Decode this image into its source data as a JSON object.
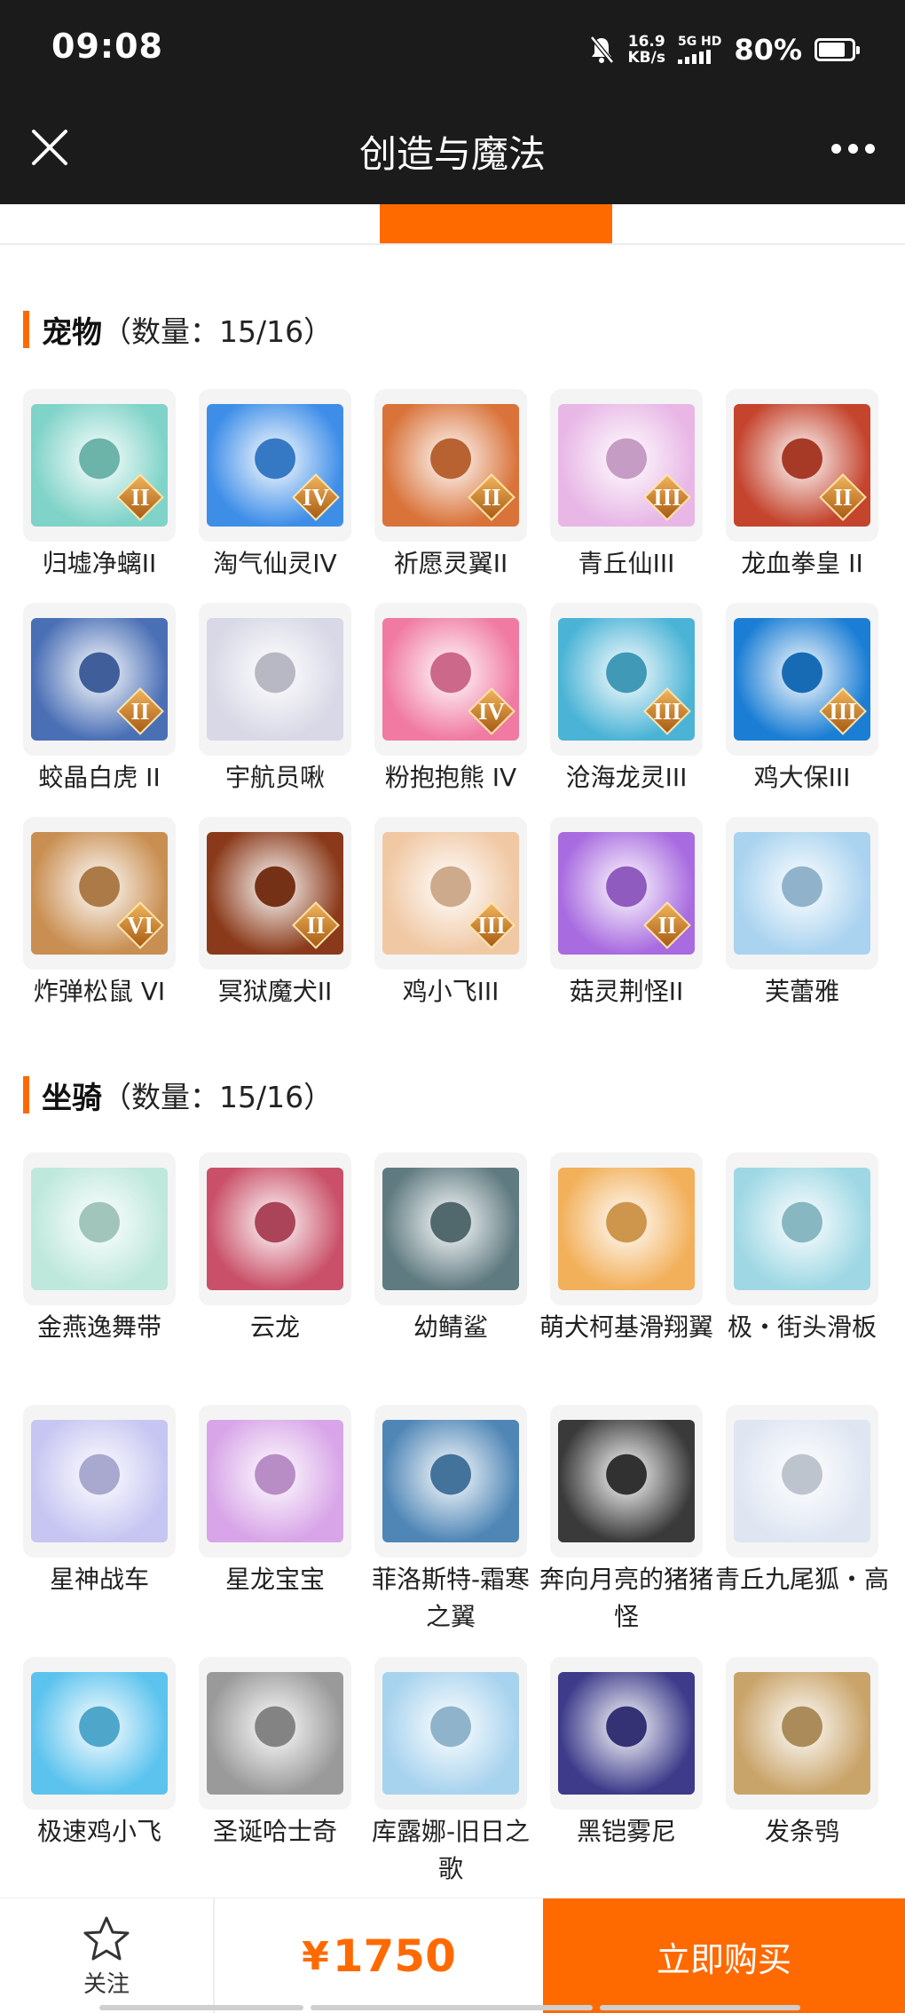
{
  "status_bar": {
    "time": "09:08",
    "speed_value": "16.9",
    "speed_unit": "KB/s",
    "network": "5G HD",
    "battery": "80%",
    "battery_level": 0.8
  },
  "header": {
    "title": "创造与魔法",
    "close_icon": "close-icon",
    "more_icon": "more-icon"
  },
  "pets": {
    "name": "宠物",
    "count": "（数量：15/16）",
    "items": [
      {
        "label": "归墟净螭II",
        "badge": "II",
        "color": "#7fd3c8",
        "icon": "dragon-icon"
      },
      {
        "label": "淘气仙灵IV",
        "badge": "IV",
        "color": "#3e8ee8",
        "icon": "pet-icon"
      },
      {
        "label": "祈愿灵翼II",
        "badge": "II",
        "color": "#d9733a",
        "icon": "bird-icon"
      },
      {
        "label": "青丘仙III",
        "badge": "III",
        "color": "#e8b7e6",
        "icon": "fox-spirit-icon"
      },
      {
        "label": "龙血拳皇 II",
        "badge": "II",
        "color": "#c4442e",
        "icon": "beast-icon"
      },
      {
        "label": "蛟晶白虎 II",
        "badge": "II",
        "color": "#4a6fb5",
        "icon": "tiger-icon"
      },
      {
        "label": "宇航员啾",
        "badge": "",
        "color": "#d8d8e6",
        "icon": "astronaut-icon"
      },
      {
        "label": "粉抱抱熊 IV",
        "badge": "IV",
        "color": "#f07aa2",
        "icon": "bear-icon"
      },
      {
        "label": "沧海龙灵III",
        "badge": "III",
        "color": "#4bb4d6",
        "icon": "dragon-spirit-icon"
      },
      {
        "label": "鸡大保III",
        "badge": "III",
        "color": "#1b7ed4",
        "icon": "chicken-icon"
      },
      {
        "label": "炸弹松鼠 VI",
        "badge": "VI",
        "color": "#c98f52",
        "icon": "squirrel-icon"
      },
      {
        "label": "冥狱魔犬II",
        "badge": "II",
        "color": "#8a3a1a",
        "icon": "hound-icon"
      },
      {
        "label": "鸡小飞III",
        "badge": "III",
        "color": "#f0c8a4",
        "icon": "chick-icon"
      },
      {
        "label": "菇灵荆怪II",
        "badge": "II",
        "color": "#a86be0",
        "icon": "mushroom-icon"
      },
      {
        "label": "芙蕾雅",
        "badge": "",
        "color": "#a9d3ef",
        "icon": "valkyrie-icon"
      }
    ]
  },
  "mounts": {
    "name": "坐骑",
    "count": "（数量：15/16）",
    "items": [
      {
        "label": "金燕逸舞带",
        "color": "#bfe8dc",
        "icon": "ribbon-icon"
      },
      {
        "label": "云龙",
        "color": "#c95068",
        "icon": "dragon-icon"
      },
      {
        "label": "幼鲭鲨",
        "color": "#5f7a80",
        "icon": "shark-icon"
      },
      {
        "label": "萌犬柯基滑翔翼",
        "color": "#f2b05a",
        "icon": "corgi-icon"
      },
      {
        "label": "极・街头滑板",
        "color": "#9fd8e4",
        "icon": "skateboard-icon"
      },
      {
        "label": "星神战车",
        "color": "#c7c6f2",
        "icon": "chariot-icon"
      },
      {
        "label": "星龙宝宝",
        "color": "#d8a6e8",
        "icon": "baby-dragon-icon"
      },
      {
        "label": "菲洛斯特-霜寒之翼",
        "color": "#4f86b6",
        "icon": "frost-wing-icon"
      },
      {
        "label": "奔向月亮的猪猪怪",
        "color": "#3a3a3a",
        "icon": "pig-icon"
      },
      {
        "label": "青丘九尾狐・高",
        "color": "#dfe6f2",
        "icon": "fox-icon"
      },
      {
        "label": "极速鸡小飞",
        "color": "#5cc3ee",
        "icon": "bird-icon"
      },
      {
        "label": "圣诞哈士奇",
        "color": "#9a9a9a",
        "icon": "husky-icon"
      },
      {
        "label": "库露娜-旧日之歌",
        "color": "#a8d3ee",
        "icon": "sheep-icon"
      },
      {
        "label": "黑铠雾尼",
        "color": "#3d3b8a",
        "icon": "dark-dragon-icon"
      },
      {
        "label": "发条鸮",
        "color": "#c9a46a",
        "icon": "owl-icon"
      }
    ]
  },
  "footer": {
    "follow_label": "关注",
    "currency": "¥",
    "price": "1750",
    "buy_label": "立即购买",
    "brand_color": "#ff6a00"
  }
}
